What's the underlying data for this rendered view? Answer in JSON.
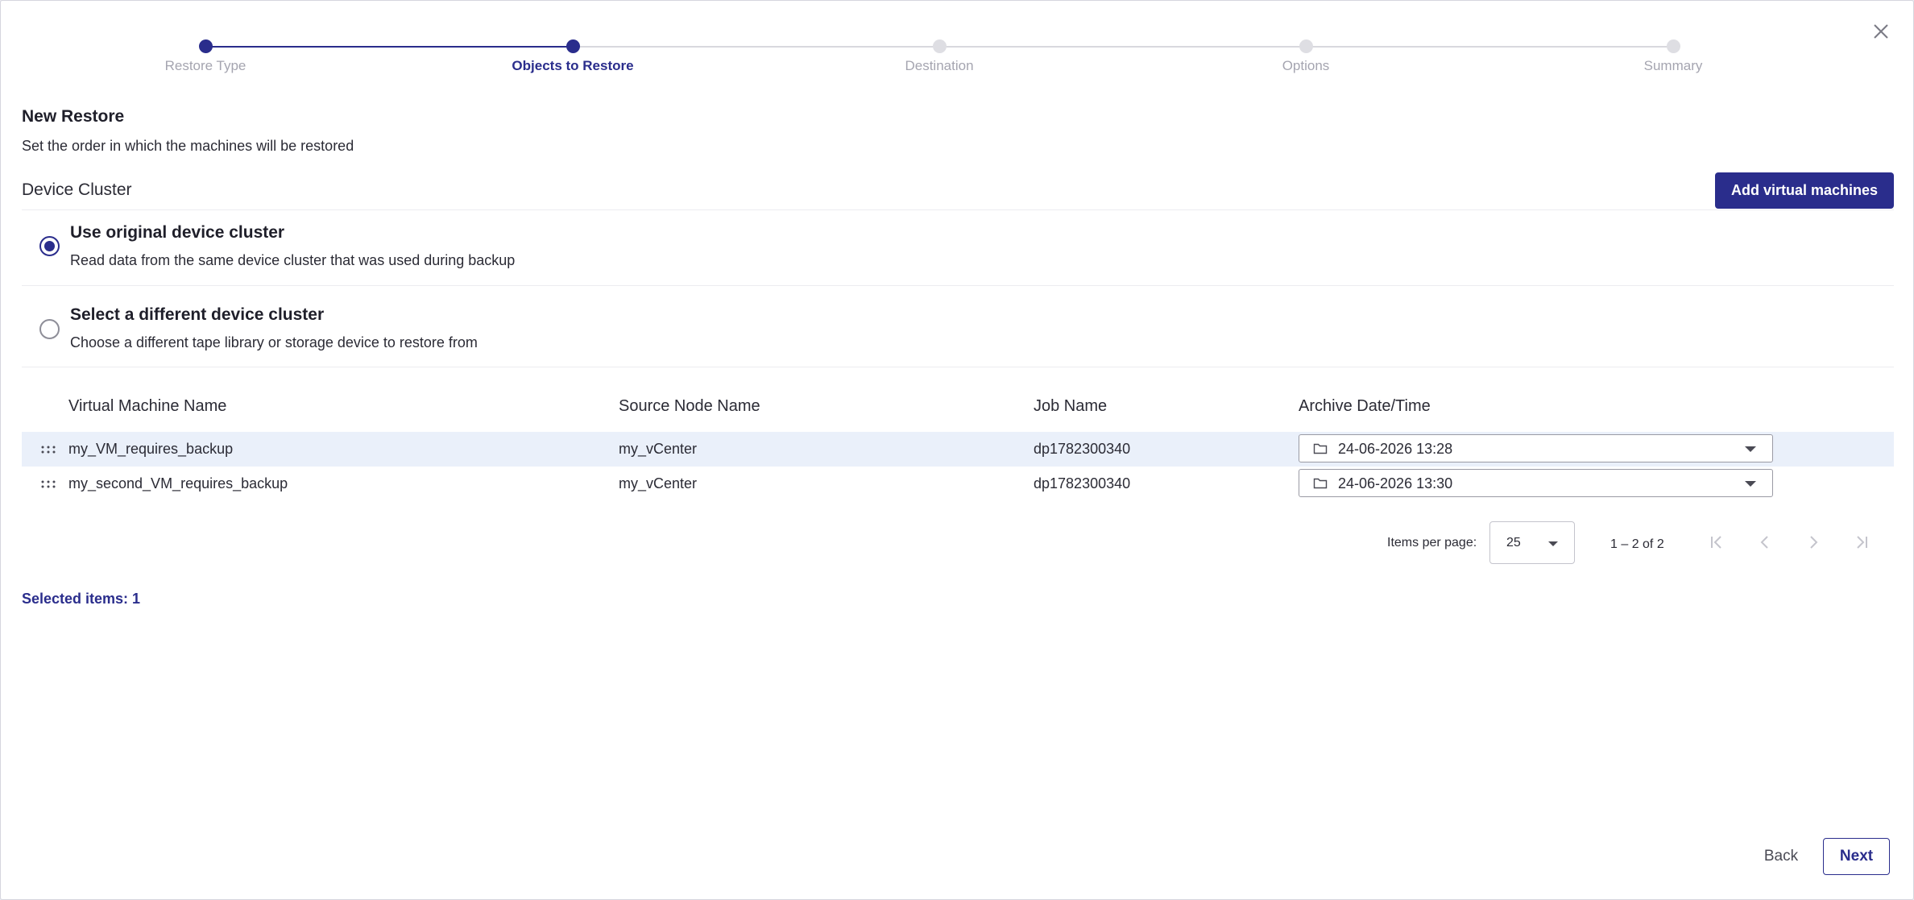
{
  "stepper": {
    "steps": [
      {
        "label": "Restore Type",
        "state": "done"
      },
      {
        "label": "Objects to Restore",
        "state": "active"
      },
      {
        "label": "Destination",
        "state": "pending"
      },
      {
        "label": "Options",
        "state": "pending"
      },
      {
        "label": "Summary",
        "state": "pending"
      }
    ]
  },
  "header": {
    "title": "New Restore",
    "subtitle": "Set the order in which the machines will be restored"
  },
  "device_cluster": {
    "section_title": "Device Cluster",
    "add_button_label": "Add virtual machines",
    "options": [
      {
        "title": "Use original device cluster",
        "description": "Read data from the same device cluster that was used during backup",
        "checked": true
      },
      {
        "title": "Select a different device cluster",
        "description": "Choose a different tape library or storage device to restore from",
        "checked": false
      }
    ]
  },
  "table": {
    "columns": [
      "Virtual Machine Name",
      "Source Node Name",
      "Job Name",
      "Archive Date/Time"
    ],
    "rows": [
      {
        "vm_name": "my_VM_requires_backup",
        "source_node": "my_vCenter",
        "job_name": "dp1782300340",
        "archive_datetime": "24-06-2026 13:28",
        "selected": true
      },
      {
        "vm_name": "my_second_VM_requires_backup",
        "source_node": "my_vCenter",
        "job_name": "dp1782300340",
        "archive_datetime": "24-06-2026 13:30",
        "selected": false
      }
    ]
  },
  "paginator": {
    "items_per_page_label": "Items per page:",
    "items_per_page": "25",
    "range_label": "1 – 2 of 2"
  },
  "footer": {
    "selected_items": "Selected items: 1",
    "back_label": "Back",
    "next_label": "Next"
  },
  "colors": {
    "accent": "#2a2d8c",
    "selected_row": "#eaf0fa",
    "inactive_step": "#dedee3"
  },
  "icons": {
    "close": "close-icon",
    "drag": "drag-handle-icon",
    "folder": "folder-icon",
    "dropdown": "chevron-down-icon",
    "first_page": "first-page-icon",
    "prev_page": "chevron-left-icon",
    "next_page": "chevron-right-icon",
    "last_page": "last-page-icon"
  }
}
